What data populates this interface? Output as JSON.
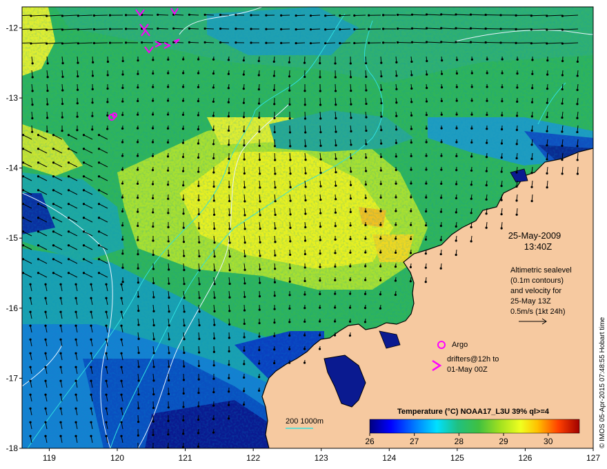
{
  "map": {
    "lon_range": [
      118.6,
      127.0
    ],
    "lat_range": [
      -18.0,
      -11.7
    ],
    "lon_ticks": [
      "119",
      "120",
      "121",
      "122",
      "123",
      "124",
      "125",
      "126",
      "127"
    ],
    "lat_ticks": [
      "-12",
      "-13",
      "-14",
      "-15",
      "-16",
      "-17",
      "-18"
    ],
    "colors": {
      "land": "#f6c9a0",
      "contour": "#e8f4ff",
      "depth_contour": "#30e0e0",
      "velocity_arrow": "#000000",
      "drifter": "#ff00ff",
      "argo": "#ff00ff"
    }
  },
  "date_label": "25-May-2009",
  "time_label": "13:40Z",
  "altimetry_notes": [
    "Altimetric sealevel",
    "(0.1m contours)",
    "and velocity for",
    "25-May 13Z",
    "0.5m/s (1kt 24h)"
  ],
  "argo_label": "Argo",
  "drifter_label": [
    "drifters@12h to",
    "01-May 00Z"
  ],
  "depth_scale_label": "200  1000m",
  "credit": "© IMOS 05-Apr-2015 07:48:55 Hobart time",
  "colorbar": {
    "title": "Temperature (°C) NOAA17_L3U 39% ql>=4",
    "range": [
      26,
      30.7
    ],
    "ticks": [
      "26",
      "27",
      "28",
      "29",
      "30"
    ],
    "colormap": [
      "#00007f",
      "#0000ff",
      "#0080ff",
      "#00e0ff",
      "#20c0a0",
      "#20c040",
      "#80d020",
      "#e0ff20",
      "#ffd000",
      "#ff8000",
      "#ff2000",
      "#a00000"
    ]
  }
}
